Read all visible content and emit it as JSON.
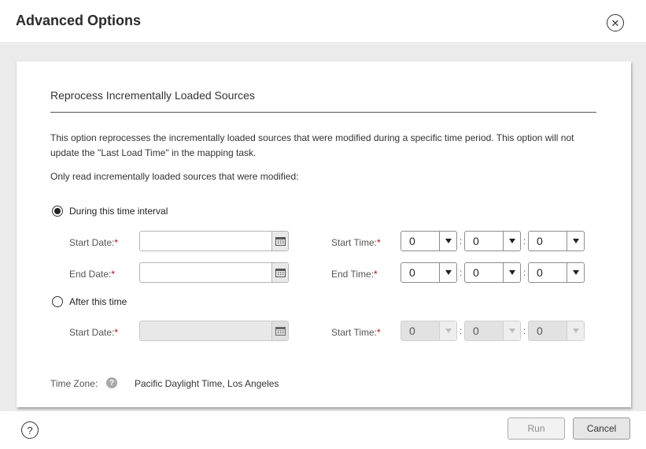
{
  "dialog": {
    "title": "Advanced Options",
    "close_glyph": "✕"
  },
  "section": {
    "title": "Reprocess Incrementally Loaded Sources",
    "description": "This option reprocesses the incrementally loaded sources that were modified during a specific time period. This option will not update the \"Last Load Time\" in the mapping task.",
    "only_read_label": "Only read incrementally loaded sources that were modified:"
  },
  "interval": {
    "option_label": "During this time interval",
    "selected": true,
    "start_date_label": "Start Date:",
    "end_date_label": "End Date:",
    "start_date_value": "",
    "end_date_value": "",
    "start_time_label": "Start Time:",
    "end_time_label": "End Time:",
    "start_time": [
      "0",
      "0",
      "0"
    ],
    "end_time": [
      "0",
      "0",
      "0"
    ]
  },
  "after": {
    "option_label": "After this time",
    "selected": false,
    "start_date_label": "Start Date:",
    "start_date_value": "",
    "start_time_label": "Start Time:",
    "start_time": [
      "0",
      "0",
      "0"
    ]
  },
  "required_marker": "*",
  "time_separator": ":",
  "timezone": {
    "label": "Time Zone:",
    "help_glyph": "?",
    "value": "Pacific Daylight Time, Los Angeles"
  },
  "footer": {
    "help_glyph": "?",
    "run_label": "Run",
    "cancel_label": "Cancel"
  },
  "colors": {
    "required": "#cc0000",
    "body_bg": "#ebebeb",
    "panel_bg": "#ffffff"
  }
}
